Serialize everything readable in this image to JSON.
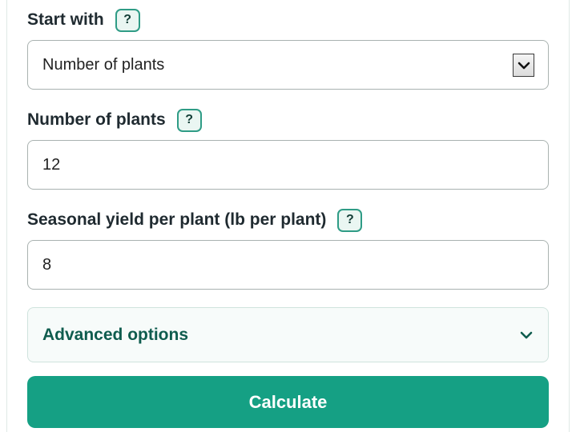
{
  "start_with": {
    "label": "Start with",
    "help": "?",
    "selected": "Number of plants"
  },
  "number_of_plants": {
    "label": "Number of plants",
    "help": "?",
    "value": "12"
  },
  "seasonal_yield": {
    "label": "Seasonal yield per plant (lb per plant)",
    "help": "?",
    "value": "8"
  },
  "advanced": {
    "label": "Advanced options",
    "icon": "chevron-down-icon"
  },
  "calculate": {
    "label": "Calculate"
  },
  "colors": {
    "accent": "#15a084",
    "accent_dark": "#0f5c4e",
    "help_border": "#2f9c86",
    "help_bg": "#eaf6f2"
  }
}
